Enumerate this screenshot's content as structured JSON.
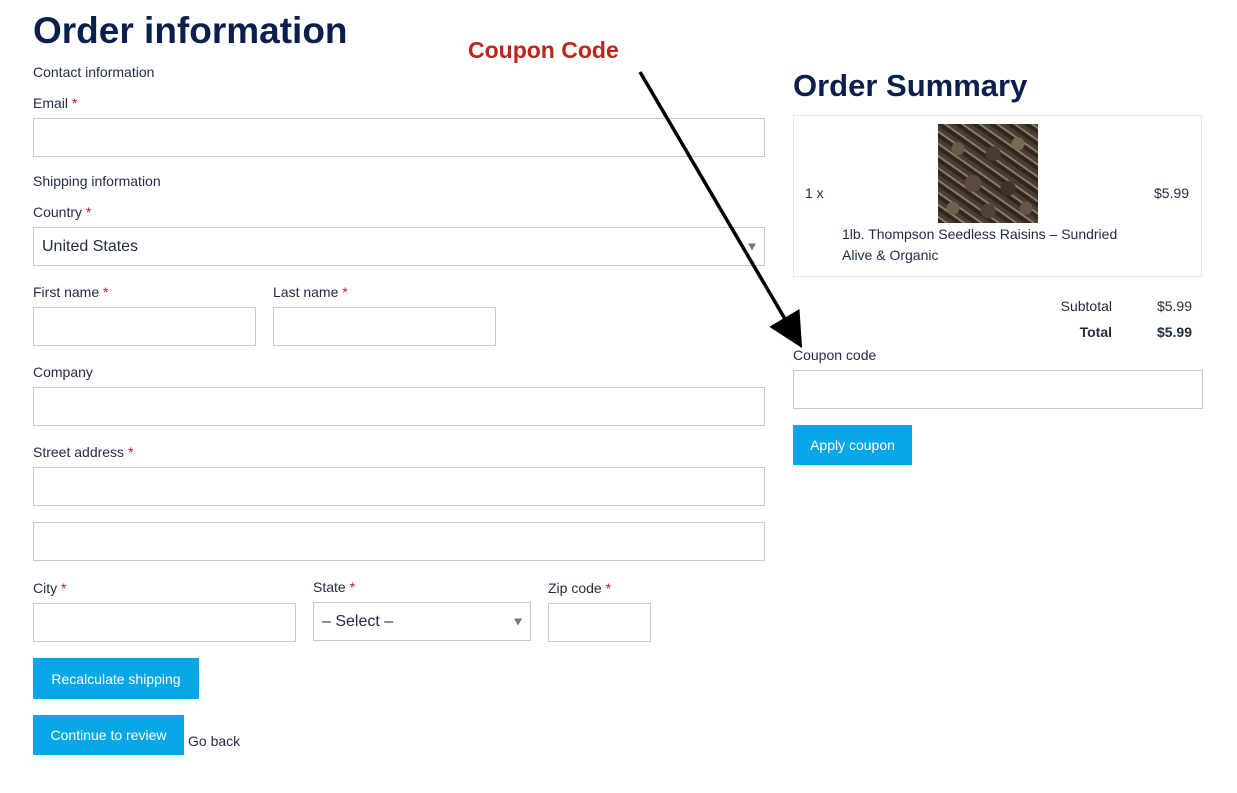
{
  "left": {
    "title": "Order information",
    "contact_heading": "Contact information",
    "email_label": "Email",
    "shipping_heading": "Shipping information",
    "country_label": "Country",
    "country_value": "United States",
    "first_name_label": "First name",
    "last_name_label": "Last name",
    "company_label": "Company",
    "street_label": "Street address",
    "city_label": "City",
    "state_label": "State",
    "state_value": "– Select –",
    "zip_label": "Zip code",
    "required_mark": "*",
    "recalc_button": "Recalculate shipping",
    "continue_button": "Continue to review",
    "go_back_link": "Go back"
  },
  "annotation": {
    "text": "Coupon Code",
    "color": "#c0231a"
  },
  "summary": {
    "title": "Order Summary",
    "item": {
      "qty": "1 x",
      "name_line1": "1lb. Thompson Seedless Raisins – Sundried",
      "name_line2": "Alive & Organic",
      "price": "$5.99"
    },
    "subtotal_label": "Subtotal",
    "subtotal_value": "$5.99",
    "total_label": "Total",
    "total_value": "$5.99",
    "coupon_label": "Coupon code",
    "apply_button": "Apply coupon"
  },
  "colors": {
    "heading": "#0b1f4d",
    "button": "#07a6e6",
    "required": "#c8102e"
  }
}
